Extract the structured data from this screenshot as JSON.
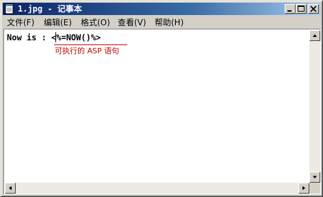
{
  "window": {
    "title": "1.jpg - 记事本",
    "icon": "notepad-icon",
    "controls": [
      "minimize-icon",
      "maximize-icon",
      "close-icon"
    ]
  },
  "menu": [
    {
      "label": "文件(F)"
    },
    {
      "label": "编辑(E)"
    },
    {
      "label": "格式(O)"
    },
    {
      "label": "查看(V)"
    },
    {
      "label": "帮助(H)"
    }
  ],
  "editor": {
    "content": "Now is : <%=NOW()%>",
    "annotation": "可执行的 ASP 语句",
    "annotation_color": "#cc0000"
  },
  "colors": {
    "title_start": "#0a246a",
    "title_end": "#a6caf0",
    "chrome": "#d4d0c8"
  }
}
